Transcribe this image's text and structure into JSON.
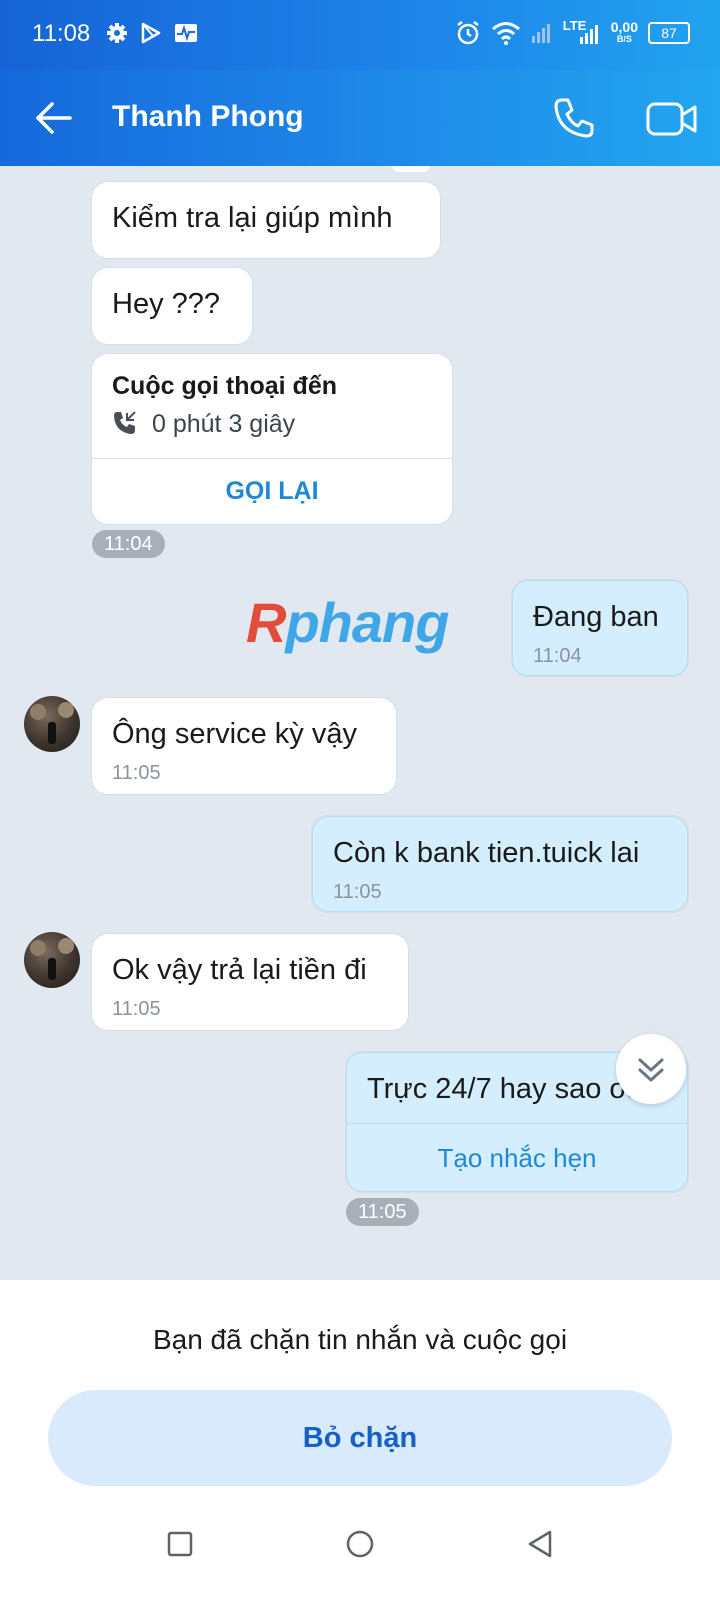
{
  "status_bar": {
    "time": "11:08",
    "network": "LTE",
    "speed_value": "0,00",
    "speed_unit": "B/S",
    "battery": "87",
    "icons": [
      "gear-icon",
      "play-store-icon",
      "activity-icon",
      "alarm-icon",
      "wifi-icon",
      "signal-icon",
      "battery-icon"
    ]
  },
  "header": {
    "back_icon": "arrow-left-icon",
    "contact_name": "Thanh Phong",
    "call_icon": "phone-icon",
    "video_icon": "video-camera-icon"
  },
  "messages": [
    {
      "side": "them",
      "text": "Kiểm tra lại giúp mình"
    },
    {
      "side": "them",
      "text": "Hey ???"
    },
    {
      "side": "them",
      "type": "call",
      "title": "Cuộc gọi thoại đến",
      "duration": "0 phút 3 giây",
      "action": "GỌI LẠI",
      "time": "11:04"
    },
    {
      "side": "me",
      "text": "Đang ban",
      "time": "11:04"
    },
    {
      "side": "them",
      "text": "Ông service kỳ vậy",
      "time": "11:05"
    },
    {
      "side": "me",
      "text": "Còn k bank tien.tuick lai",
      "time": "11:05"
    },
    {
      "side": "them",
      "text": "Ok vậy trả lại tiền đi",
      "time": "11:05"
    },
    {
      "side": "me",
      "text": "Trực 24/7 hay sao oo",
      "action": "Tạo nhắc hẹn",
      "time": "11:05"
    }
  ],
  "watermark": {
    "first": "R",
    "rest": "phang"
  },
  "blocked": {
    "message": "Bạn đã chặn tin nhắn và cuộc gọi",
    "unblock_label": "Bỏ chặn"
  },
  "navbar": {
    "icons": [
      "recent-apps-icon",
      "home-icon",
      "back-triangle-icon"
    ]
  },
  "colors": {
    "header": "#1f8ae9",
    "my_bubble": "#d5eefe",
    "link": "#1e88d8"
  }
}
